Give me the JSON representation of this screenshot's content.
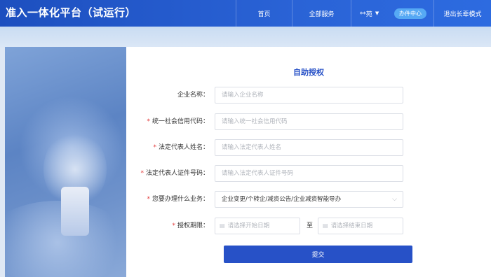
{
  "header": {
    "brand": "准入一体化平台（试运行）",
    "nav": {
      "home": "首页",
      "services": "全部服务",
      "user": "**苑",
      "office": "办件中心",
      "elder_mode": "退出长辈模式"
    }
  },
  "form": {
    "title": "自助授权",
    "fields": [
      {
        "label": "企业名称：",
        "required": false,
        "placeholder": "请输入企业名称"
      },
      {
        "label": "统一社会信用代码：",
        "required": true,
        "placeholder": "请输入统一社会信用代码"
      },
      {
        "label": "法定代表人姓名：",
        "required": true,
        "placeholder": "请输入法定代表人姓名"
      },
      {
        "label": "法定代表人证件号码：",
        "required": true,
        "placeholder": "请输入法定代表人证件号码"
      }
    ],
    "business": {
      "label": "您要办理什么业务：",
      "value": "企业变更/个转企/减资公告/企业减资智能导办"
    },
    "period": {
      "label": "授权期限：",
      "start_placeholder": "请选择开始日期",
      "separator": "至",
      "end_placeholder": "请选择结束日期"
    },
    "submit_label": "提交"
  },
  "colors": {
    "primary": "#2751c7",
    "header": "#1d4fbf",
    "required": "#e23a3a",
    "pill": "#56a9f4"
  }
}
